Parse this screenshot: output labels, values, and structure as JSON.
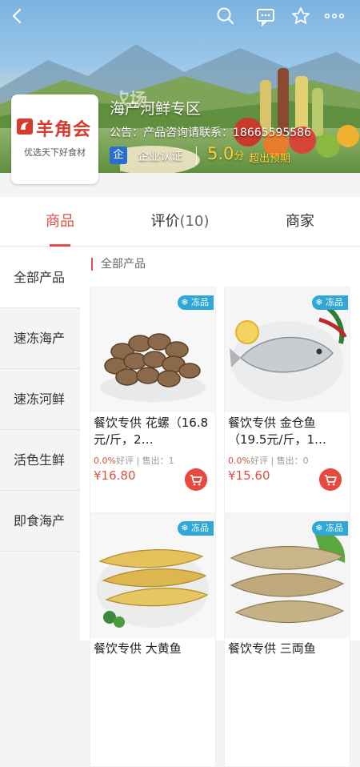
{
  "shop": {
    "logo_text": "羊角会",
    "logo_sub": "优选天下好食材",
    "name": "海产河鲜专区",
    "notice": "公告：产品咨询请联系：18665595586",
    "cert_badge": "企",
    "cert_label": "企业认证",
    "score": "5.0",
    "score_unit": "分",
    "score_note": "超出预期"
  },
  "tabs": [
    {
      "label": "商品"
    },
    {
      "label": "评价",
      "count": "(10)"
    },
    {
      "label": "商家"
    }
  ],
  "sidebar": {
    "items": [
      {
        "label": "全部产品"
      },
      {
        "label": "速冻海产"
      },
      {
        "label": "速冻河鲜"
      },
      {
        "label": "活色生鲜"
      },
      {
        "label": "即食海产"
      }
    ]
  },
  "main": {
    "section_title": "全部产品",
    "products": [
      {
        "title": "餐饮专供 花螺（16.8元/斤，2…",
        "rating": "0.0%",
        "rating_label": "好评",
        "sales": "售出：1",
        "price": "¥16.80",
        "badge": "冻品"
      },
      {
        "title": "餐饮专供 金仓鱼（19.5元/斤，1…",
        "rating": "0.0%",
        "rating_label": "好评",
        "sales": "售出：0",
        "price": "¥15.60",
        "badge": "冻品"
      },
      {
        "title": "餐饮专供 大黄鱼",
        "badge": "冻品"
      },
      {
        "title": "餐饮专供 三両鱼",
        "badge": "冻品"
      }
    ]
  },
  "colors": {
    "accent": "#e25046",
    "badge": "#2fa8d8",
    "score": "#ffd233"
  },
  "icons": [
    "back-icon",
    "search-icon",
    "message-icon",
    "star-icon",
    "more-icon",
    "cart-icon",
    "snowflake-icon"
  ]
}
